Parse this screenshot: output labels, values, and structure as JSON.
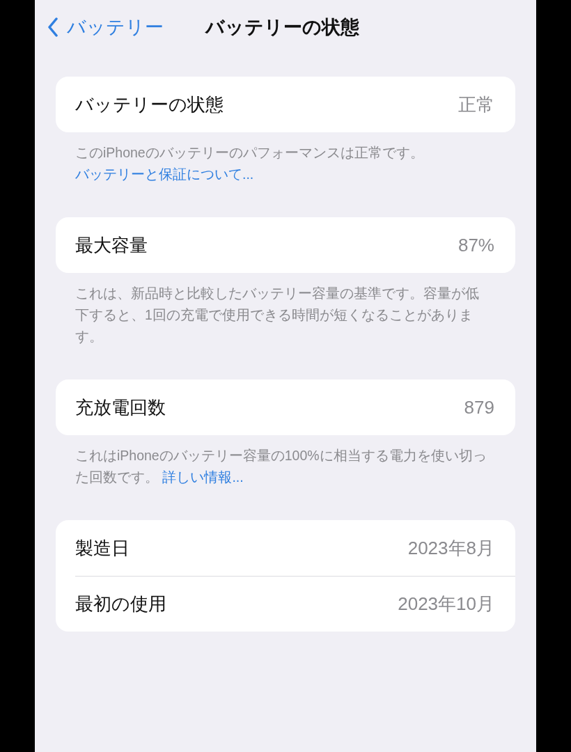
{
  "nav": {
    "back_label": "バッテリー",
    "title": "バッテリーの状態"
  },
  "sections": [
    {
      "rows": [
        {
          "label": "バッテリーの状態",
          "value": "正常"
        }
      ],
      "footer": {
        "text": "このiPhoneのバッテリーのパフォーマンスは正常です。",
        "link": "バッテリーと保証について..."
      }
    },
    {
      "rows": [
        {
          "label": "最大容量",
          "value": "87%"
        }
      ],
      "footer": {
        "text": "これは、新品時と比較したバッテリー容量の基準です。容量が低下すると、1回の充電で使用できる時間が短くなることがあります。"
      }
    },
    {
      "rows": [
        {
          "label": "充放電回数",
          "value": "879"
        }
      ],
      "footer": {
        "text": "これはiPhoneのバッテリー容量の100%に相当する電力を使い切った回数です。",
        "link": "詳しい情報..."
      }
    },
    {
      "rows": [
        {
          "label": "製造日",
          "value": "2023年8月"
        },
        {
          "label": "最初の使用",
          "value": "2023年10月"
        }
      ]
    }
  ]
}
